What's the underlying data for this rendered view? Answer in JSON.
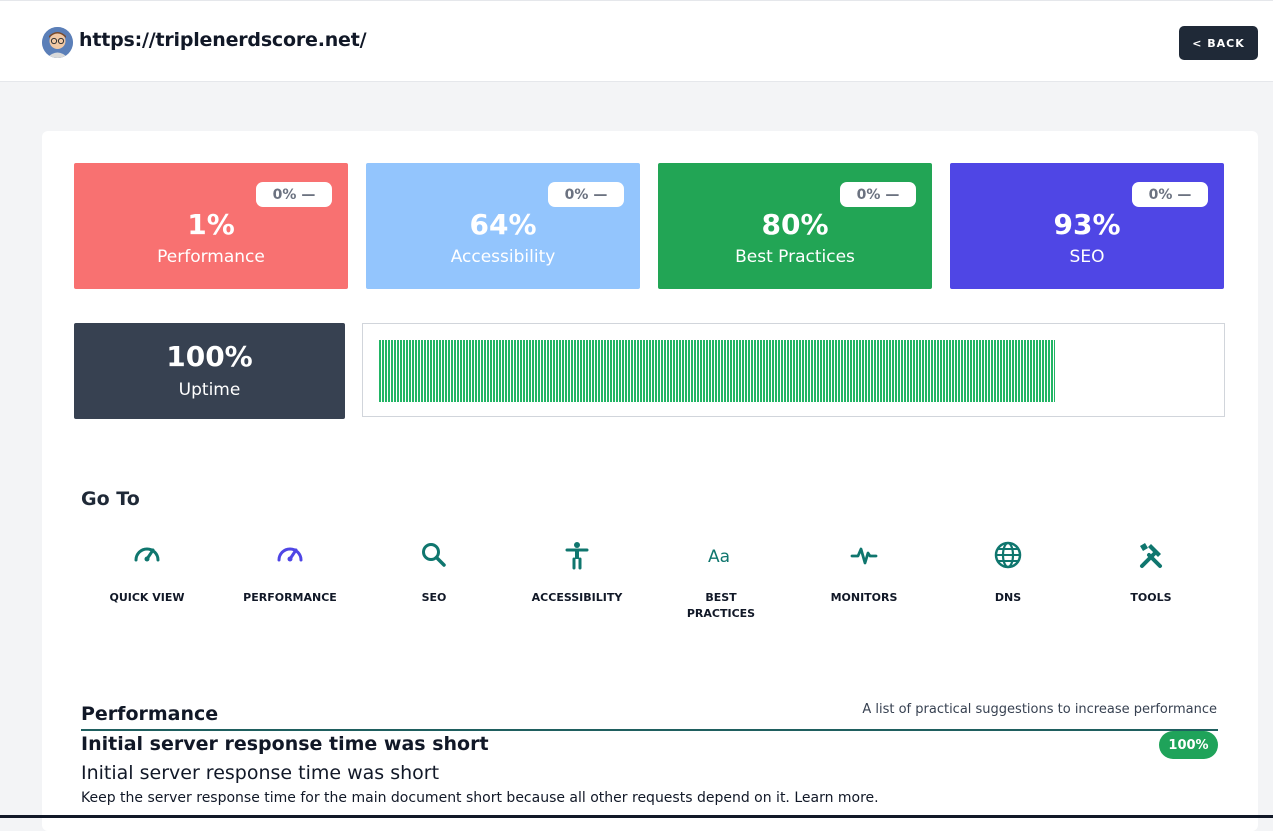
{
  "header": {
    "url": "https://triplenerdscore.net/",
    "back_label": "< BACK"
  },
  "scores": [
    {
      "value": "1%",
      "label": "Performance",
      "change": "0% —",
      "color": "#f87171"
    },
    {
      "value": "64%",
      "label": "Accessibility",
      "change": "0% —",
      "color": "#93c5fd"
    },
    {
      "value": "80%",
      "label": "Best Practices",
      "change": "0% —",
      "color": "#22a555"
    },
    {
      "value": "93%",
      "label": "SEO",
      "change": "0% —",
      "color": "#4f46e5"
    }
  ],
  "uptime": {
    "value": "100%",
    "label": "Uptime",
    "bar_color": "#22b565"
  },
  "goto": {
    "title": "Go To",
    "items": [
      {
        "label": "QUICK VIEW",
        "icon": "speedometer-icon"
      },
      {
        "label": "PERFORMANCE",
        "icon": "speedometer-icon"
      },
      {
        "label": "SEO",
        "icon": "search-icon"
      },
      {
        "label": "ACCESSIBILITY",
        "icon": "accessibility-icon"
      },
      {
        "label": "BEST PRACTICES",
        "icon": "font-icon"
      },
      {
        "label": "MONITORS",
        "icon": "pulse-icon"
      },
      {
        "label": "DNS",
        "icon": "globe-icon"
      },
      {
        "label": "TOOLS",
        "icon": "tools-icon"
      }
    ]
  },
  "performance": {
    "title": "Performance",
    "subtitle": "A list of practical suggestions to increase performance",
    "audit": {
      "heading": "Initial server response time was short",
      "score": "100%",
      "title": "Initial server response time was short",
      "description": "Keep the server response time for the main document short because all other requests depend on it. Learn more."
    }
  }
}
